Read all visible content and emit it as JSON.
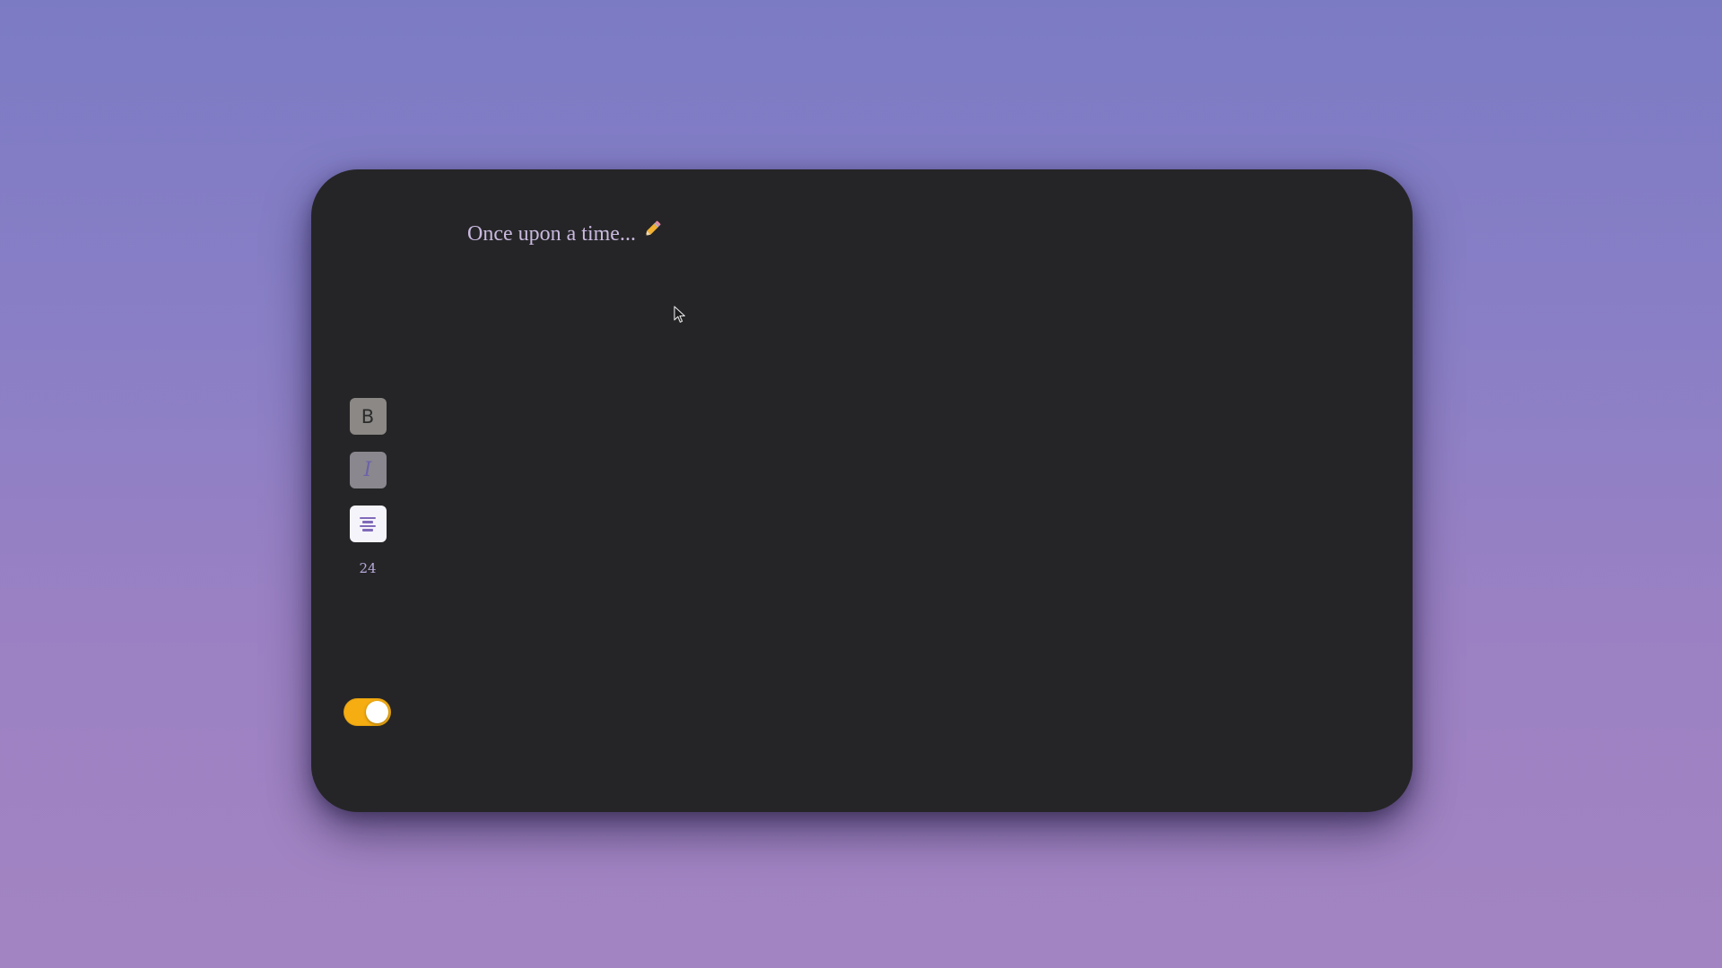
{
  "editor": {
    "text": "Once upon a time...",
    "trailing_icon": "pencil-icon"
  },
  "toolbar": {
    "bold_label": "B",
    "italic_label": "I",
    "align_icon": "align-center-icon",
    "font_size": "24"
  },
  "theme_toggle": {
    "state": "on",
    "color": "#f5ad12"
  },
  "colors": {
    "background_top": "#7b7bc4",
    "background_bottom": "#a384c2",
    "card": "#252527",
    "text": "#c9b9df",
    "accent": "#7f6ab9"
  }
}
